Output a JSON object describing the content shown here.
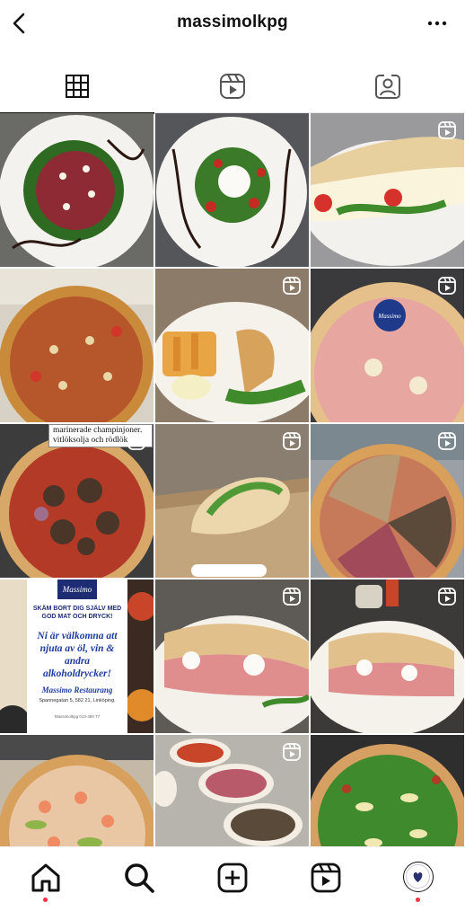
{
  "header": {
    "username": "massimolkpg",
    "back_icon": "chevron-left-icon",
    "more_icon": "more-horizontal-icon"
  },
  "tabs": [
    {
      "name": "posts-grid",
      "icon": "grid-icon",
      "active": true
    },
    {
      "name": "reels",
      "icon": "reels-icon",
      "active": false
    },
    {
      "name": "tagged",
      "icon": "tagged-person-icon",
      "active": false
    }
  ],
  "posts": [
    {
      "subject": "carpaccio",
      "is_reel": false
    },
    {
      "subject": "burrata-salad",
      "is_reel": false
    },
    {
      "subject": "pizza-sandwich",
      "is_reel": true
    },
    {
      "subject": "pizza-in-box",
      "is_reel": false
    },
    {
      "subject": "fries-and-panuozzo",
      "is_reel": true
    },
    {
      "subject": "prosciutto-pizza",
      "is_reel": true
    },
    {
      "subject": "mushroom-beef-pizza",
      "is_reel": true,
      "caption": "marinerade champinjoner, vitlöksolja och rödlök"
    },
    {
      "subject": "calzone-in-box",
      "is_reel": true
    },
    {
      "subject": "mixed-pizza",
      "is_reel": true
    },
    {
      "subject": "restaurant-poster",
      "is_reel": false,
      "poster": {
        "logo": "Massimo",
        "headline": "SKÄM BORT DIG SJÄLV MED GOD MAT OCH DRYCK!",
        "main": "Ni är välkomna att njuta av öl, vin & andra alkoholdrycker!",
        "name": "Massimo Restaurang",
        "address": "Spannegatan 5, 582 21, Linköping.",
        "small": "Massimolkpg 013-480 77"
      }
    },
    {
      "subject": "prosciutto-panuozzo",
      "is_reel": true
    },
    {
      "subject": "prosciutto-panuozzo-2",
      "is_reel": true
    },
    {
      "subject": "shrimp-pizza",
      "is_reel": false
    },
    {
      "subject": "pizza-bases",
      "is_reel": true
    },
    {
      "subject": "arugula-pizza",
      "is_reel": false
    }
  ],
  "bottom_nav": [
    {
      "name": "home",
      "icon": "home-icon",
      "notification": true
    },
    {
      "name": "search",
      "icon": "search-icon",
      "notification": false
    },
    {
      "name": "create",
      "icon": "plus-square-icon",
      "notification": false
    },
    {
      "name": "reels",
      "icon": "reels-icon",
      "notification": false
    },
    {
      "name": "profile",
      "icon": "profile-avatar-icon",
      "notification": true
    }
  ],
  "colors": {
    "notification_dot": "#ff3040",
    "poster_blue": "#1e3ca0",
    "text": "#111111"
  }
}
